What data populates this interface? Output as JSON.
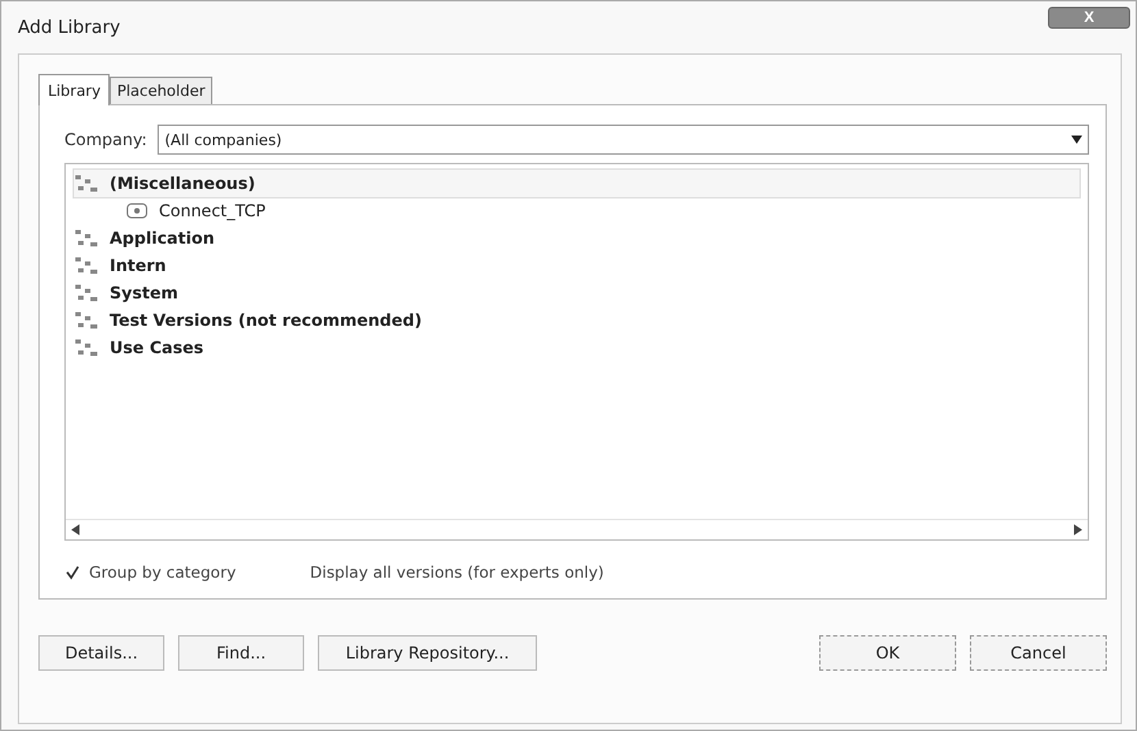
{
  "window": {
    "title": "Add Library",
    "close_label": "X"
  },
  "tabs": [
    {
      "label": "Library",
      "selected": true
    },
    {
      "label": "Placeholder",
      "selected": false
    }
  ],
  "company": {
    "label": "Company:",
    "value": "(All companies)"
  },
  "tree": [
    {
      "label": "(Miscellaneous)",
      "expanded": true,
      "children": [
        {
          "label": "Connect_TCP"
        }
      ]
    },
    {
      "label": "Application",
      "expanded": false
    },
    {
      "label": "Intern",
      "expanded": false
    },
    {
      "label": "System",
      "expanded": false
    },
    {
      "label": "Test Versions (not recommended)",
      "expanded": false
    },
    {
      "label": "Use Cases",
      "expanded": false
    }
  ],
  "options": [
    {
      "label": "Group by category",
      "checked": true
    },
    {
      "label": "Display all versions (for experts only)",
      "checked": false
    }
  ],
  "buttons": [
    {
      "label": "Details...",
      "kind": "left"
    },
    {
      "label": "Find...",
      "kind": "left"
    },
    {
      "label": "Library Repository...",
      "kind": "left"
    },
    {
      "label": "OK",
      "kind": "right"
    },
    {
      "label": "Cancel",
      "kind": "right"
    }
  ]
}
